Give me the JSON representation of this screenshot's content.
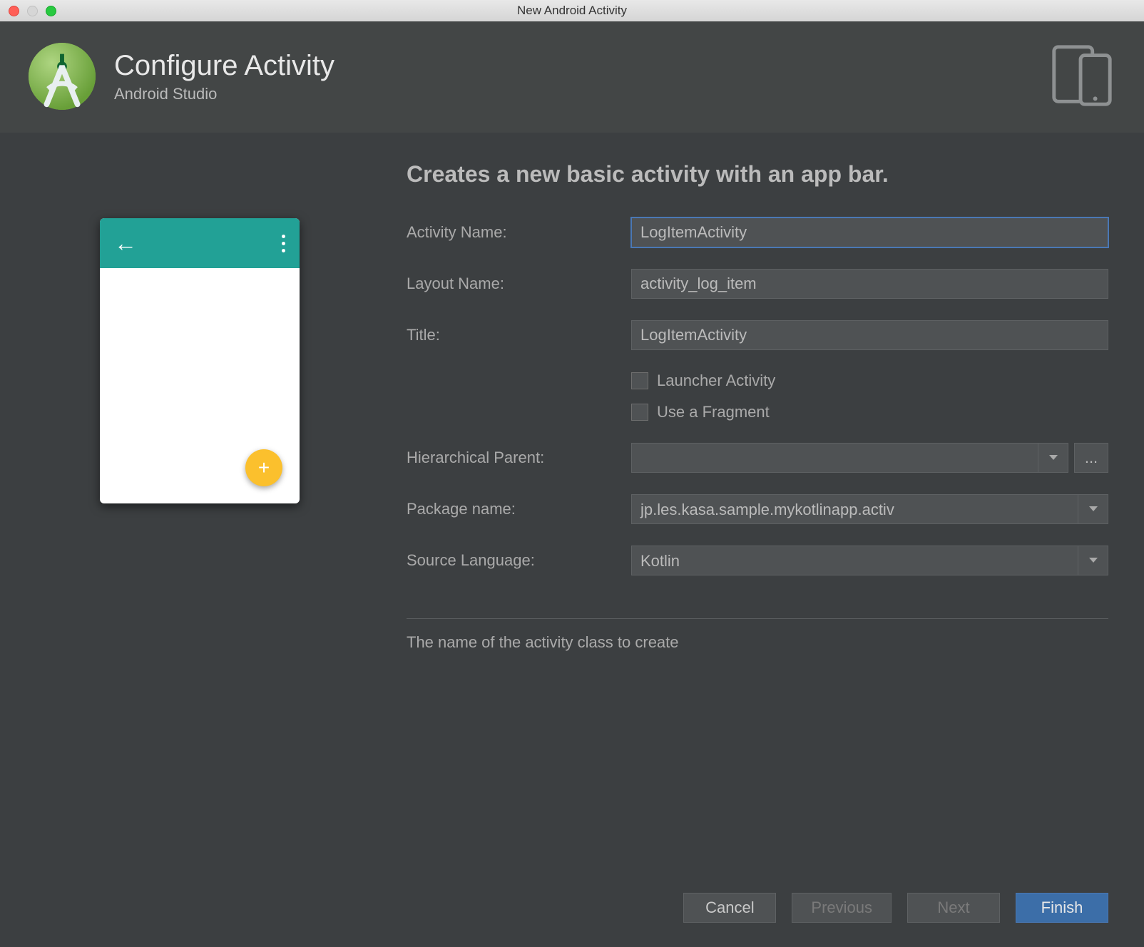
{
  "window": {
    "title": "New Android Activity"
  },
  "header": {
    "title": "Configure Activity",
    "subtitle": "Android Studio"
  },
  "section": {
    "description": "Creates a new basic activity with an app bar."
  },
  "form": {
    "activity_name_label": "Activity Name:",
    "activity_name_value": "LogItemActivity",
    "layout_name_label": "Layout Name:",
    "layout_name_value": "activity_log_item",
    "title_label": "Title:",
    "title_value": "LogItemActivity",
    "launcher_checkbox_label": "Launcher Activity",
    "fragment_checkbox_label": "Use a Fragment",
    "hierarchical_parent_label": "Hierarchical Parent:",
    "hierarchical_parent_value": "",
    "browse_label": "...",
    "package_name_label": "Package name:",
    "package_name_value": "jp.les.kasa.sample.mykotlinapp.activ",
    "source_language_label": "Source Language:",
    "source_language_value": "Kotlin"
  },
  "hint": "The name of the activity class to create",
  "buttons": {
    "cancel": "Cancel",
    "previous": "Previous",
    "next": "Next",
    "finish": "Finish"
  }
}
